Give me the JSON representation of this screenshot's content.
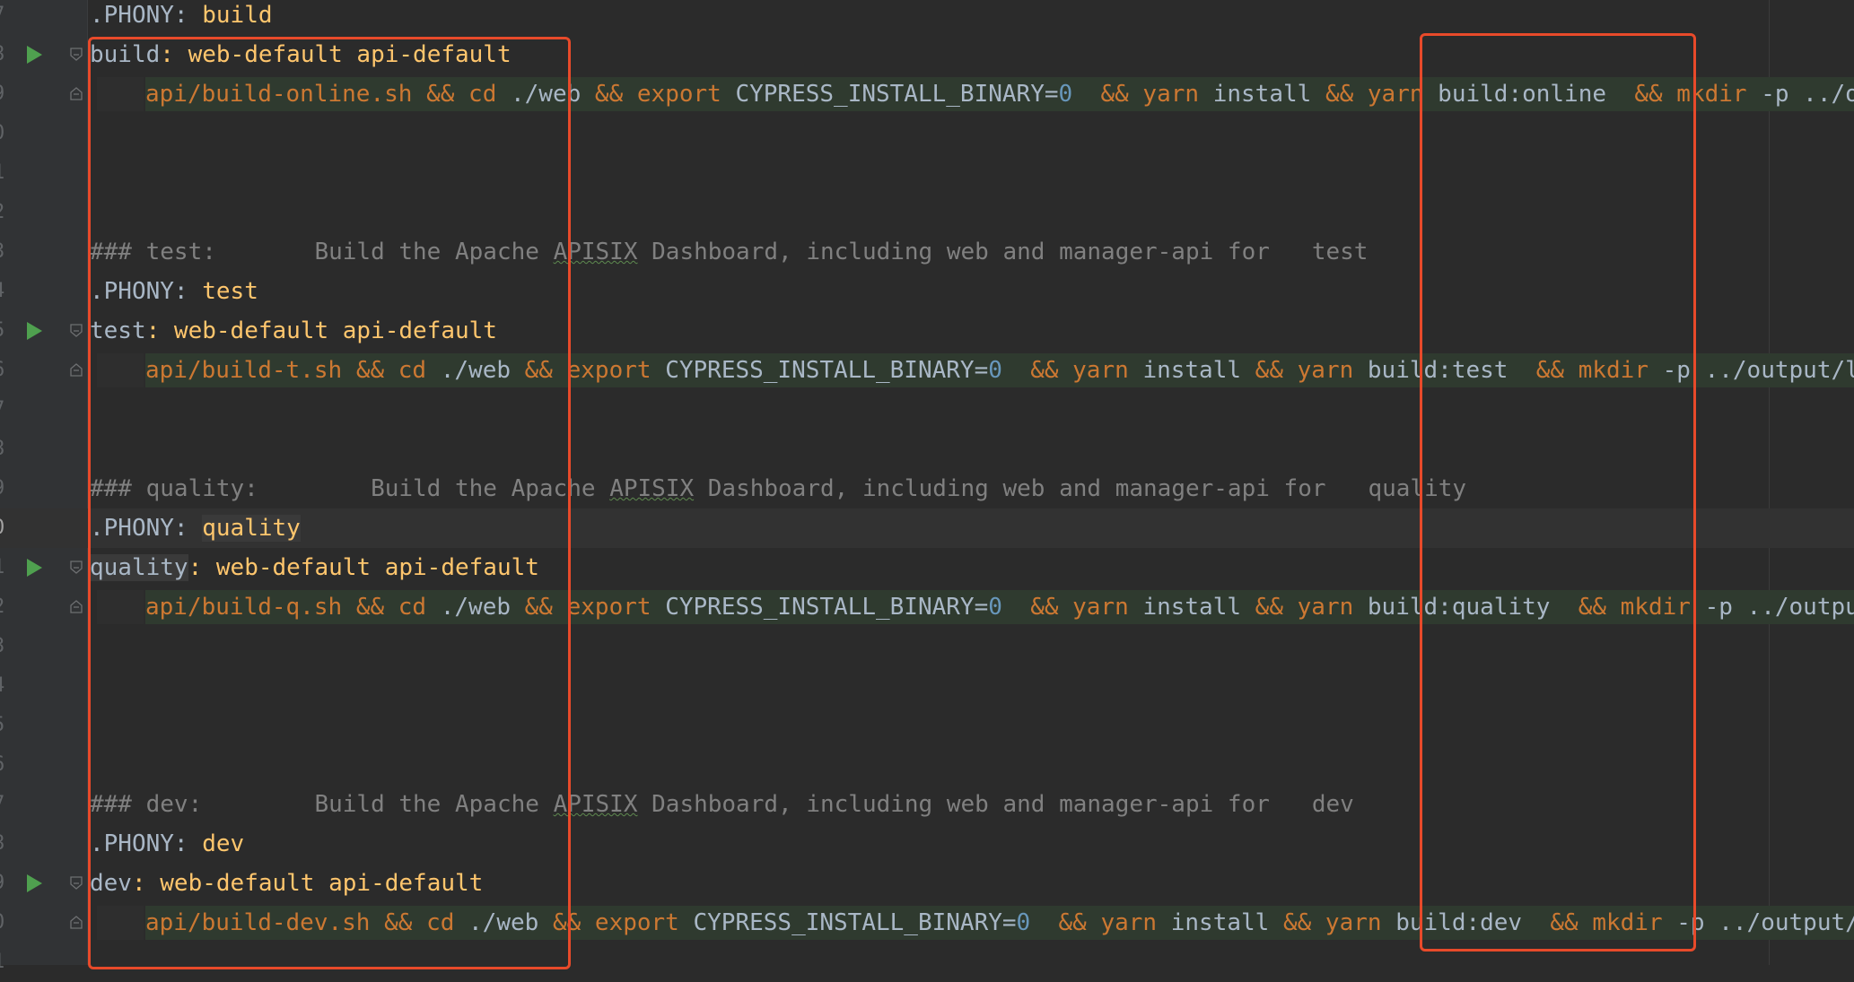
{
  "editor": {
    "lines": [
      {
        "n": "7",
        "segments": [
          {
            "t": ".PHONY: ",
            "c": "plain"
          },
          {
            "t": "build",
            "c": "tgt"
          }
        ]
      },
      {
        "n": "8",
        "run": true,
        "fold": true,
        "segments": [
          {
            "t": "build",
            "c": "plain"
          },
          {
            "t": ": web-default api-default",
            "c": "tgt"
          }
        ]
      },
      {
        "n": "9",
        "recipe": true,
        "fold": true,
        "segments": [
          {
            "t": "api/build-online.sh ",
            "c": "kw"
          },
          {
            "t": "&& cd ",
            "c": "kw"
          },
          {
            "t": "./web ",
            "c": "plain"
          },
          {
            "t": "&& export ",
            "c": "kw"
          },
          {
            "t": "CYPRESS_INSTALL_BINARY=",
            "c": "plain"
          },
          {
            "t": "0",
            "c": "num"
          },
          {
            "t": "  && yarn ",
            "c": "kw"
          },
          {
            "t": "install ",
            "c": "plain"
          },
          {
            "t": "&& yarn ",
            "c": "kw"
          },
          {
            "t": "build:online  ",
            "c": "plain"
          },
          {
            "t": "&& mkdir ",
            "c": "kw"
          },
          {
            "t": "-p ../output/",
            "c": "plain"
          }
        ]
      },
      {
        "n": "0",
        "segments": []
      },
      {
        "n": "1",
        "segments": []
      },
      {
        "n": "2",
        "segments": []
      },
      {
        "n": "3",
        "segments": [
          {
            "t": "### test:       Build the Apache ",
            "c": "cmt"
          },
          {
            "t": "APISIX",
            "c": "cmt typo"
          },
          {
            "t": " Dashboard, including web and manager-api for   test",
            "c": "cmt"
          }
        ]
      },
      {
        "n": "4",
        "segments": [
          {
            "t": ".PHONY: ",
            "c": "plain"
          },
          {
            "t": "test",
            "c": "tgt"
          }
        ]
      },
      {
        "n": "5",
        "run": true,
        "fold": true,
        "segments": [
          {
            "t": "test",
            "c": "plain"
          },
          {
            "t": ": web-default api-default",
            "c": "tgt"
          }
        ]
      },
      {
        "n": "6",
        "recipe": true,
        "fold": true,
        "segments": [
          {
            "t": "api/build-t.sh ",
            "c": "kw"
          },
          {
            "t": "&& cd ",
            "c": "kw"
          },
          {
            "t": "./web ",
            "c": "plain"
          },
          {
            "t": "&& export ",
            "c": "kw"
          },
          {
            "t": "CYPRESS_INSTALL_BINARY=",
            "c": "plain"
          },
          {
            "t": "0",
            "c": "num"
          },
          {
            "t": "  && yarn ",
            "c": "kw"
          },
          {
            "t": "install ",
            "c": "plain"
          },
          {
            "t": "&& yarn ",
            "c": "kw"
          },
          {
            "t": "build:test  ",
            "c": "plain"
          },
          {
            "t": "&& mkdir ",
            "c": "kw"
          },
          {
            "t": "-p ../output/l",
            "c": "plain"
          }
        ]
      },
      {
        "n": "7",
        "segments": []
      },
      {
        "n": "8",
        "segments": []
      },
      {
        "n": "9",
        "segments": [
          {
            "t": "### quality:        Build the Apache ",
            "c": "cmt"
          },
          {
            "t": "APISIX",
            "c": "cmt typo"
          },
          {
            "t": " Dashboard, including web and manager-api for   quality",
            "c": "cmt"
          }
        ]
      },
      {
        "n": "0",
        "active": true,
        "segments": [
          {
            "t": ".PHONY: ",
            "c": "plain"
          },
          {
            "t": "quality",
            "c": "tgt sel"
          }
        ]
      },
      {
        "n": "1",
        "run": true,
        "fold": true,
        "segments": [
          {
            "t": "quality",
            "c": "plain sel"
          },
          {
            "t": ": web-default api-default",
            "c": "tgt"
          }
        ]
      },
      {
        "n": "2",
        "recipe": true,
        "fold": true,
        "segments": [
          {
            "t": "api/build-q.sh ",
            "c": "kw"
          },
          {
            "t": "&& cd ",
            "c": "kw"
          },
          {
            "t": "./web ",
            "c": "plain"
          },
          {
            "t": "&& export ",
            "c": "kw"
          },
          {
            "t": "CYPRESS_INSTALL_BINARY=",
            "c": "plain"
          },
          {
            "t": "0",
            "c": "num"
          },
          {
            "t": "  && yarn ",
            "c": "kw"
          },
          {
            "t": "install ",
            "c": "plain"
          },
          {
            "t": "&& yarn ",
            "c": "kw"
          },
          {
            "t": "build:quality  ",
            "c": "plain"
          },
          {
            "t": "&& mkdir ",
            "c": "kw"
          },
          {
            "t": "-p ../outpu",
            "c": "plain"
          }
        ]
      },
      {
        "n": "3",
        "segments": []
      },
      {
        "n": "4",
        "segments": []
      },
      {
        "n": "5",
        "segments": []
      },
      {
        "n": "6",
        "segments": []
      },
      {
        "n": "7",
        "segments": [
          {
            "t": "### dev:        Build the Apache ",
            "c": "cmt"
          },
          {
            "t": "APISIX",
            "c": "cmt typo"
          },
          {
            "t": " Dashboard, including web and manager-api for   dev",
            "c": "cmt"
          }
        ]
      },
      {
        "n": "8",
        "segments": [
          {
            "t": ".PHONY: ",
            "c": "plain"
          },
          {
            "t": "dev",
            "c": "tgt"
          }
        ]
      },
      {
        "n": "9",
        "run": true,
        "fold": true,
        "segments": [
          {
            "t": "dev",
            "c": "plain"
          },
          {
            "t": ": web-default api-default",
            "c": "tgt"
          }
        ]
      },
      {
        "n": "0",
        "recipe": true,
        "fold": true,
        "segments": [
          {
            "t": "api/build-dev.sh ",
            "c": "kw"
          },
          {
            "t": "&& cd ",
            "c": "kw"
          },
          {
            "t": "./web ",
            "c": "plain"
          },
          {
            "t": "&& export ",
            "c": "kw"
          },
          {
            "t": "CYPRESS_INSTALL_BINARY=",
            "c": "plain"
          },
          {
            "t": "0",
            "c": "num"
          },
          {
            "t": "  && yarn ",
            "c": "kw"
          },
          {
            "t": "install ",
            "c": "plain"
          },
          {
            "t": "&& yarn ",
            "c": "kw"
          },
          {
            "t": "build:dev  ",
            "c": "plain"
          },
          {
            "t": "&& mkdir ",
            "c": "kw"
          },
          {
            "t": "-p ../output/",
            "c": "plain"
          }
        ]
      },
      {
        "n": "1",
        "segments": []
      }
    ]
  },
  "annotations": {
    "color": "#e84a2a",
    "boxes": [
      {
        "label": "highlight-left"
      },
      {
        "label": "highlight-right"
      }
    ]
  }
}
